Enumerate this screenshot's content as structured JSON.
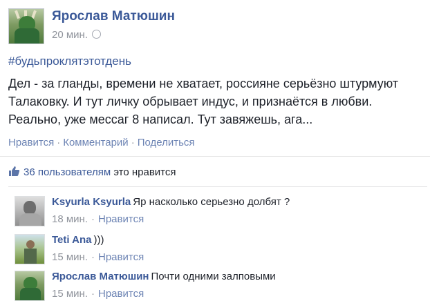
{
  "post": {
    "author": "Ярослав Матюшин",
    "time": "20 мин.",
    "hashtag": "#будьпроклятэтотдень",
    "lines": [
      "Дел - за гланды, времени не хватает, россияне серьёзно штурмуют",
      "Талаковку. И тут личку обрывает индус, и признаётся в любви.",
      "Реально, уже мессаг 8 написал. Тут завяжешь, ага..."
    ],
    "actions": {
      "like": "Нравится",
      "comment": "Комментарий",
      "share": "Поделиться",
      "separator": "·"
    },
    "likes_link": "36 пользователям",
    "likes_rest": "это нравится",
    "icons": {
      "privacy": "globe-icon",
      "likes": "thumbs-up-icon"
    }
  },
  "comments": [
    {
      "author": "Ksyurla Ksyurla",
      "text": "Яр насколько серьезно долбят ?",
      "time": "18 мин.",
      "like": "Нравится"
    },
    {
      "author": "Teti Ana",
      "text": ")))",
      "time": "15 мин.",
      "like": "Нравится"
    },
    {
      "author": "Ярослав Матюшин",
      "text": "Почти одними залповыми",
      "time": "15 мин.",
      "like": "Нравится"
    }
  ],
  "colors": {
    "link": "#3b5998",
    "action": "#6d84b4",
    "meta": "#90949c",
    "text": "#1d2129"
  }
}
